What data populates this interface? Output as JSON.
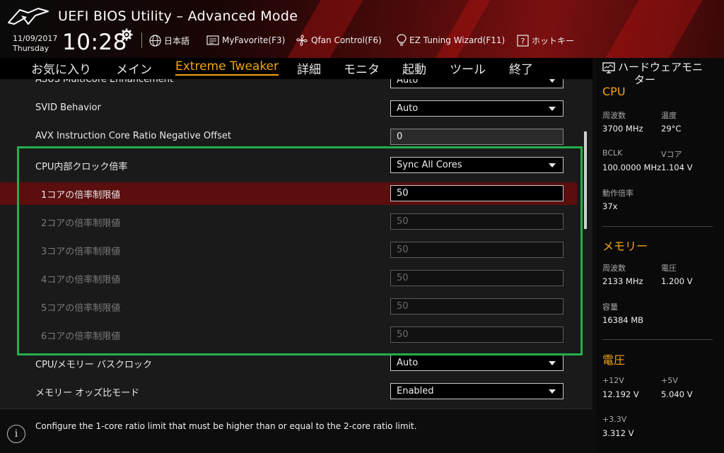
{
  "header": {
    "app_title": "UEFI BIOS Utility – Advanced Mode",
    "date": "11/09/2017",
    "day": "Thursday",
    "time": "10:28",
    "tools": {
      "language": "日本語",
      "my_favorite": "MyFavorite(F3)",
      "qfan": "Qfan Control(F6)",
      "ez_tuning": "EZ Tuning Wizard(F11)",
      "hotkeys": "ホットキー"
    }
  },
  "tabs": [
    {
      "label": "お気に入り"
    },
    {
      "label": "メイン"
    },
    {
      "label": "Extreme Tweaker"
    },
    {
      "label": "詳細"
    },
    {
      "label": "モニタ"
    },
    {
      "label": "起動"
    },
    {
      "label": "ツール"
    },
    {
      "label": "終了"
    }
  ],
  "settings": {
    "asus_mce": {
      "label": "ASUS MultiCore Enhancement",
      "value": "Auto"
    },
    "svid": {
      "label": "SVID Behavior",
      "value": "Auto"
    },
    "avx_offset": {
      "label": "AVX Instruction Core Ratio Negative Offset",
      "value": "0"
    },
    "cpu_ratio": {
      "label": "CPU内部クロック倍率",
      "value": "Sync All Cores"
    },
    "core1": {
      "label": "1コアの倍率制限値",
      "value": "50"
    },
    "core2": {
      "label": "2コアの倍率制限値",
      "value": "50"
    },
    "core3": {
      "label": "3コアの倍率制限値",
      "value": "50"
    },
    "core4": {
      "label": "4コアの倍率制限値",
      "value": "50"
    },
    "core5": {
      "label": "5コアの倍率制限値",
      "value": "50"
    },
    "core6": {
      "label": "6コアの倍率制限値",
      "value": "50"
    },
    "bclk": {
      "label": "CPU/メモリー バスクロック",
      "value": "Auto"
    },
    "mem_odd": {
      "label": "メモリー オッズ比モード",
      "value": "Enabled"
    }
  },
  "help": {
    "icon": "i",
    "text": "Configure the 1-core ratio limit that must be higher than or equal to the 2-core ratio limit."
  },
  "hw_monitor": {
    "title": "ハードウェアモニ",
    "title2": "ター",
    "cpu": {
      "title": "CPU",
      "freq_label": "周波数",
      "freq": "3700 MHz",
      "temp_label": "温度",
      "temp": "29°C",
      "bclk_label": "BCLK",
      "bclk": "100.0000 MHz",
      "vcore_label": "Vコア",
      "vcore": "1.104 V",
      "ratio_label": "動作倍率",
      "ratio": "37x"
    },
    "memory": {
      "title": "メモリー",
      "freq_label": "周波数",
      "freq": "2133 MHz",
      "volt_label": "電圧",
      "volt": "1.200 V",
      "cap_label": "容量",
      "cap": "16384 MB"
    },
    "voltage": {
      "title": "電圧",
      "v12_label": "+12V",
      "v12": "12.192 V",
      "v5_label": "+5V",
      "v5": "5.040 V",
      "v33_label": "+3.3V",
      "v33": "3.312 V"
    }
  },
  "colors": {
    "accent": "#f2a30f",
    "highlight_box": "#22b14c",
    "selected_row": "#5a0e0e"
  }
}
